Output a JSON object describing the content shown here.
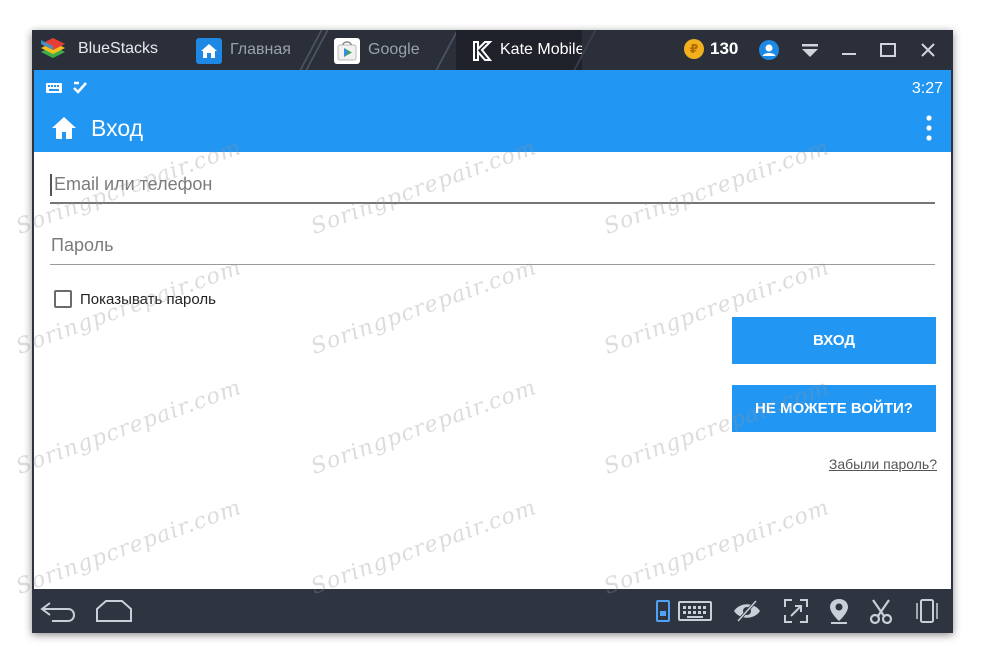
{
  "titlebar": {
    "app_name": "BlueStacks",
    "tabs": [
      {
        "label": "Главная",
        "icon": "home-icon"
      },
      {
        "label": "Google",
        "icon": "play-store-icon"
      },
      {
        "label": "Kate Mobile",
        "icon": "kate-mobile-icon"
      }
    ],
    "coins": "130"
  },
  "statusbar": {
    "time": "3:27"
  },
  "appbar": {
    "title": "Вход"
  },
  "form": {
    "login_placeholder": "Email или телефон",
    "password_placeholder": "Пароль",
    "show_password_label": "Показывать пароль",
    "login_button": "ВХОД",
    "cant_login_button": "НЕ МОЖЕТЕ ВОЙТИ?",
    "forgot_link": "Забыли пароль?"
  },
  "watermark": "Soringpcrepair.com",
  "colors": {
    "accent": "#2196f3",
    "frame": "#2e3440"
  }
}
